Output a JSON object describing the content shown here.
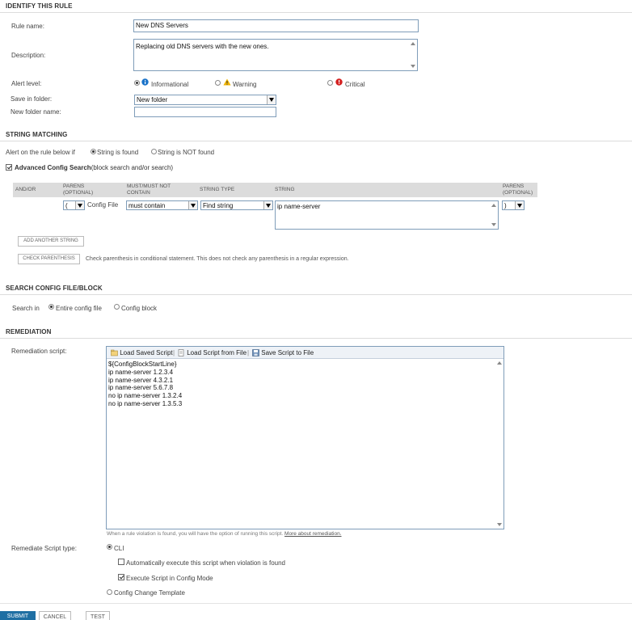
{
  "identify": {
    "heading": "IDENTIFY THIS RULE",
    "rule_name_label": "Rule name:",
    "rule_name_value": "New DNS Servers",
    "description_label": "Description:",
    "description_value": "Replacing old DNS servers with the new ones.",
    "alert_level_label": "Alert level:",
    "alert_options": [
      "Informational",
      "Warning",
      "Critical"
    ],
    "save_in_folder_label": "Save in folder:",
    "save_in_folder_value": "New folder",
    "new_folder_label": "New folder name:",
    "new_folder_value": ""
  },
  "string_matching": {
    "heading": "STRING MATCHING",
    "alert_if_label": "Alert on the rule below if",
    "option_found": "String is found",
    "option_not_found": "String is NOT found",
    "advanced_label": "Advanced Config Search",
    "advanced_hint": "(block search and/or search)",
    "columns": {
      "and_or": "AND/OR",
      "parens_open_1": "PARENS",
      "parens_open_2": "(OPTIONAL)",
      "must_1": "MUST/MUST NOT",
      "must_2": "CONTAIN",
      "string_type": "STRING TYPE",
      "string": "STRING",
      "parens_close_1": "PARENS",
      "parens_close_2": "(OPTIONAL)"
    },
    "row": {
      "paren_open": "(",
      "config_file": "Config File",
      "must": "must contain",
      "string_type": "Find string",
      "string": "ip name-server",
      "paren_close": ")"
    },
    "add_string_button": "ADD ANOTHER STRING",
    "check_paren_button": "CHECK PARENTHESIS",
    "check_paren_hint": "Check parenthesis in conditional statement. This does not check any parenthesis in a regular expression."
  },
  "search_config": {
    "heading": "SEARCH CONFIG FILE/BLOCK",
    "search_in_label": "Search in",
    "option_entire": "Entire config file",
    "option_block": "Config block"
  },
  "remediation": {
    "heading": "REMEDIATION",
    "script_label": "Remediation script:",
    "toolbar": {
      "load_saved": "Load Saved Script",
      "load_file": "Load Script from File",
      "save_file": "Save Script to File",
      "sep": "|"
    },
    "script_lines": [
      "${ConfigBlockStartLine}",
      "ip name-server  1.2.3.4",
      "ip name-server 4.3.2.1",
      "ip name-server 5.6.7.8",
      "no ip name-server 1.3.2.4",
      "no ip name-server 1.3.5.3"
    ],
    "hint": "When a rule violation is found, you will have the option of running this script.",
    "hint_link": "More about remediation.",
    "script_type_label": "Remediate Script type:",
    "type_cli": "CLI",
    "auto_execute": "Automatically execute this script when violation is found",
    "config_mode": "Execute Script in Config Mode",
    "type_template": "Config Change Template"
  },
  "footer": {
    "submit": "SUBMIT",
    "cancel": "CANCEL",
    "test": "TEST"
  },
  "colors": {
    "info": "#1a73c9",
    "warning": "#f0b400",
    "critical": "#d42020",
    "submit_bg": "#1f6fa3",
    "link": "#555555"
  }
}
